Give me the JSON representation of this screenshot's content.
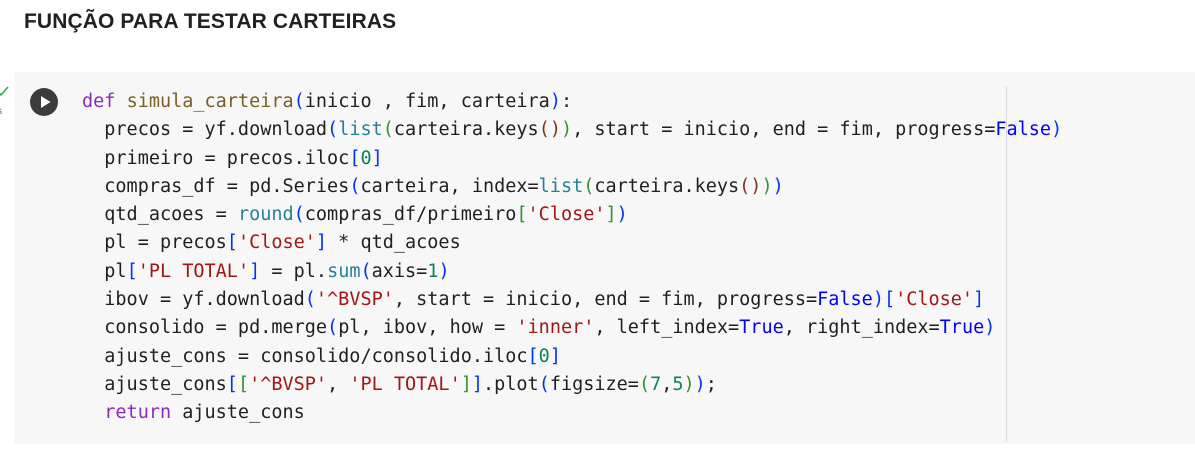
{
  "section": {
    "heading": "FUNÇÃO PARA TESTAR CARTEIRAS"
  },
  "cell": {
    "status_icon": "check-icon",
    "exec_time": "s",
    "run_icon": "play-icon",
    "code_lines": [
      [
        [
          "kw",
          "def"
        ],
        [
          "op",
          " "
        ],
        [
          "fn",
          "simula_carteira"
        ],
        [
          "br1",
          "("
        ],
        [
          "op",
          "inicio , fim, carteira"
        ],
        [
          "br1",
          ")"
        ],
        [
          "op",
          ":"
        ]
      ],
      [
        [
          "op",
          "  precos = yf.download"
        ],
        [
          "br1",
          "("
        ],
        [
          "bi",
          "list"
        ],
        [
          "br2",
          "("
        ],
        [
          "op",
          "carteira.keys"
        ],
        [
          "br3",
          "()"
        ],
        [
          "br2",
          ")"
        ],
        [
          "op",
          ", start = inicio, end = fim, progress="
        ],
        [
          "bool",
          "False"
        ],
        [
          "br1",
          ")"
        ]
      ],
      [
        [
          "op",
          "  primeiro = precos.iloc"
        ],
        [
          "br1",
          "["
        ],
        [
          "num",
          "0"
        ],
        [
          "br1",
          "]"
        ]
      ],
      [
        [
          "op",
          "  compras_df = pd.Series"
        ],
        [
          "br1",
          "("
        ],
        [
          "op",
          "carteira, index="
        ],
        [
          "bi",
          "list"
        ],
        [
          "br2",
          "("
        ],
        [
          "op",
          "carteira.keys"
        ],
        [
          "br3",
          "()"
        ],
        [
          "br2",
          ")"
        ],
        [
          "br1",
          ")"
        ]
      ],
      [
        [
          "op",
          "  qtd_acoes = "
        ],
        [
          "bi",
          "round"
        ],
        [
          "br1",
          "("
        ],
        [
          "op",
          "compras_df/primeiro"
        ],
        [
          "br2",
          "["
        ],
        [
          "str",
          "'Close'"
        ],
        [
          "br2",
          "]"
        ],
        [
          "br1",
          ")"
        ]
      ],
      [
        [
          "op",
          "  pl = precos"
        ],
        [
          "br1",
          "["
        ],
        [
          "str",
          "'Close'"
        ],
        [
          "br1",
          "]"
        ],
        [
          "op",
          " * qtd_acoes"
        ]
      ],
      [
        [
          "op",
          "  pl"
        ],
        [
          "br1",
          "["
        ],
        [
          "str",
          "'PL TOTAL'"
        ],
        [
          "br1",
          "]"
        ],
        [
          "op",
          " = pl."
        ],
        [
          "bi",
          "sum"
        ],
        [
          "br1",
          "("
        ],
        [
          "op",
          "axis="
        ],
        [
          "num",
          "1"
        ],
        [
          "br1",
          ")"
        ]
      ],
      [
        [
          "op",
          "  ibov = yf.download"
        ],
        [
          "br1",
          "("
        ],
        [
          "str",
          "'^BVSP'"
        ],
        [
          "op",
          ", start = inicio, end = fim, progress="
        ],
        [
          "bool",
          "False"
        ],
        [
          "br1",
          ")"
        ],
        [
          "br1",
          "["
        ],
        [
          "str",
          "'Close'"
        ],
        [
          "br1",
          "]"
        ]
      ],
      [
        [
          "op",
          "  consolido = pd.merge"
        ],
        [
          "br1",
          "("
        ],
        [
          "op",
          "pl, ibov, how = "
        ],
        [
          "str",
          "'inner'"
        ],
        [
          "op",
          ", left_index="
        ],
        [
          "bool",
          "True"
        ],
        [
          "op",
          ", right_index="
        ],
        [
          "bool",
          "True"
        ],
        [
          "br1",
          ")"
        ]
      ],
      [
        [
          "op",
          "  ajuste_cons = consolido/consolido.iloc"
        ],
        [
          "br1",
          "["
        ],
        [
          "num",
          "0"
        ],
        [
          "br1",
          "]"
        ]
      ],
      [
        [
          "op",
          "  ajuste_cons"
        ],
        [
          "br1",
          "["
        ],
        [
          "br2",
          "["
        ],
        [
          "str",
          "'^BVSP'"
        ],
        [
          "op",
          ", "
        ],
        [
          "str",
          "'PL TOTAL'"
        ],
        [
          "br2",
          "]"
        ],
        [
          "br1",
          "]"
        ],
        [
          "op",
          ".plot"
        ],
        [
          "br1",
          "("
        ],
        [
          "op",
          "figsize="
        ],
        [
          "br2",
          "("
        ],
        [
          "num",
          "7"
        ],
        [
          "op",
          ","
        ],
        [
          "num",
          "5"
        ],
        [
          "br2",
          ")"
        ],
        [
          "br1",
          ")"
        ],
        [
          "op",
          ";"
        ]
      ],
      [
        [
          "op",
          "  "
        ],
        [
          "kw",
          "return"
        ],
        [
          "op",
          " ajuste_cons"
        ]
      ]
    ]
  },
  "colors": {
    "cell_background": "#f7f7f7",
    "keyword": "#8d2ab8",
    "string": "#a31515",
    "number": "#098658",
    "boolean": "#0000ff",
    "builtin": "#267f99",
    "check": "#34a853"
  }
}
